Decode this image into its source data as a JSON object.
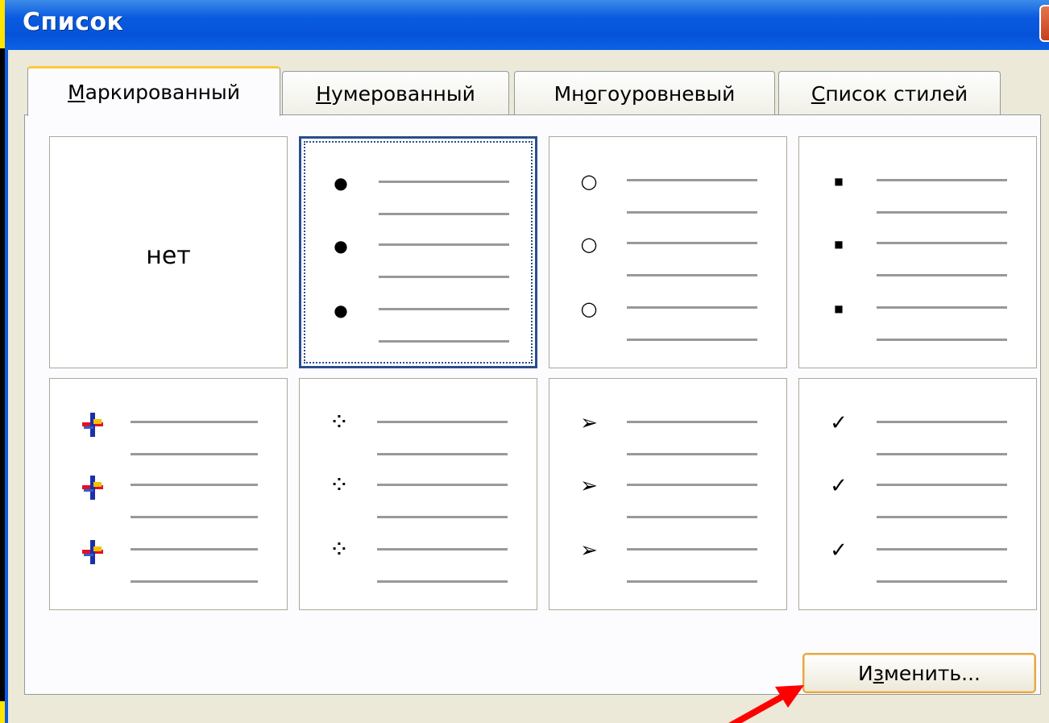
{
  "window": {
    "title": "Список",
    "close_icon": "close-icon"
  },
  "tabs": [
    {
      "pre": "",
      "u": "М",
      "post": "аркированный",
      "active": true
    },
    {
      "pre": "",
      "u": "Н",
      "post": "умерованный",
      "active": false
    },
    {
      "pre": "Мн",
      "u": "о",
      "post": "гоуровневый",
      "active": false
    },
    {
      "pre": "",
      "u": "С",
      "post": "писок стилей",
      "active": false
    }
  ],
  "bullet_styles": [
    {
      "kind": "none",
      "label": "нет",
      "selected": false
    },
    {
      "kind": "filled-circle",
      "icon": "filled-circle-bullet-icon",
      "glyph": "●",
      "selected": true
    },
    {
      "kind": "hollow-circle",
      "icon": "hollow-circle-bullet-icon",
      "glyph": "○",
      "selected": false
    },
    {
      "kind": "square",
      "icon": "square-bullet-icon",
      "glyph": "■",
      "selected": false
    },
    {
      "kind": "picture-plus",
      "icon": "picture-plus-bullet-icon",
      "glyph": "",
      "selected": false
    },
    {
      "kind": "diamond-dots",
      "icon": "four-dots-bullet-icon",
      "glyph": "⁘",
      "selected": false
    },
    {
      "kind": "arrow",
      "icon": "arrowhead-bullet-icon",
      "glyph": "➢",
      "selected": false
    },
    {
      "kind": "checkmark",
      "icon": "checkmark-bullet-icon",
      "glyph": "✓",
      "selected": false
    }
  ],
  "buttons": {
    "change": {
      "pre": "И",
      "u": "з",
      "post": "менить..."
    }
  }
}
